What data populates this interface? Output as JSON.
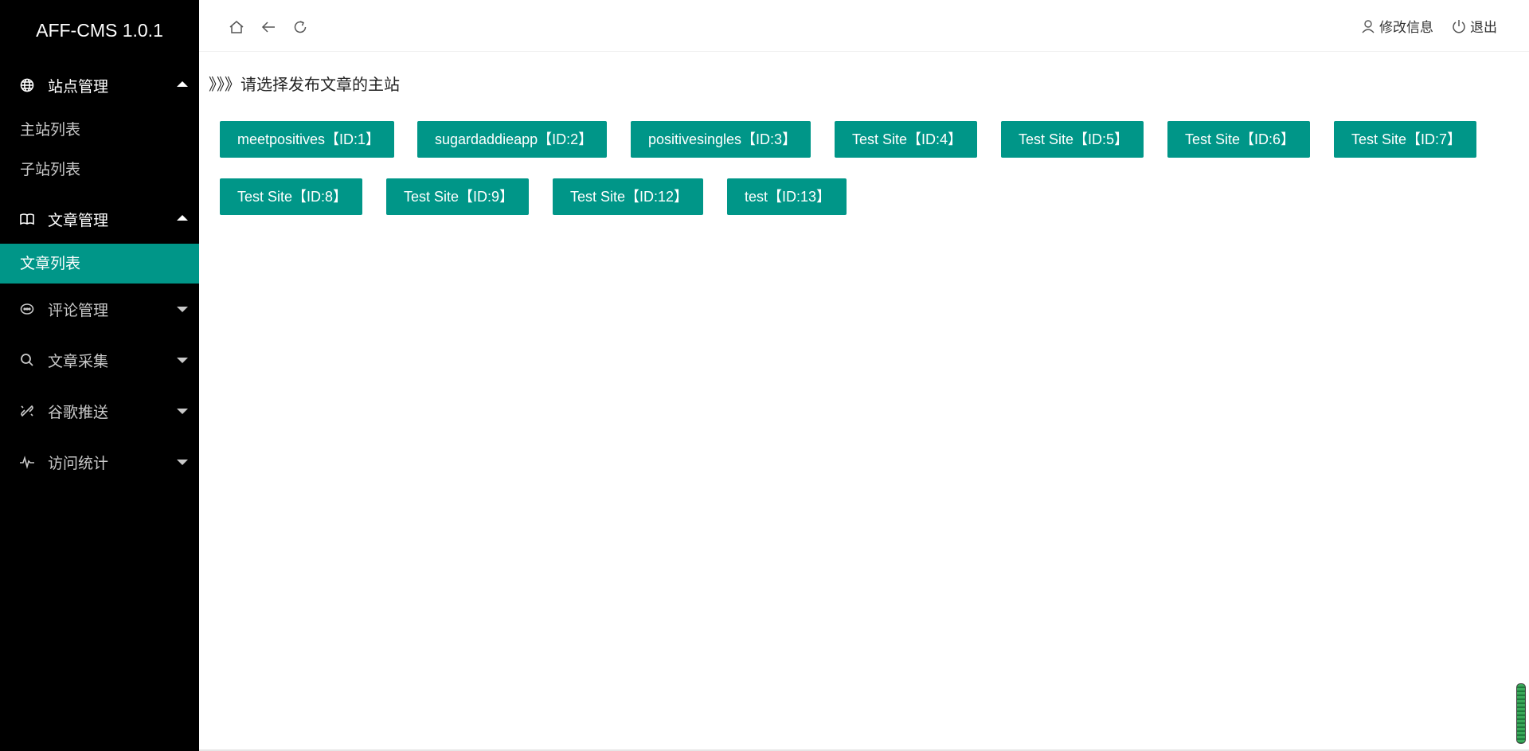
{
  "app": {
    "title": "AFF-CMS 1.0.1"
  },
  "sidebar": {
    "groups": [
      {
        "label": "站点管理",
        "icon": "globe-icon",
        "expanded": true,
        "items": [
          {
            "label": "主站列表"
          },
          {
            "label": "子站列表"
          }
        ]
      },
      {
        "label": "文章管理",
        "icon": "book-icon",
        "expanded": true,
        "items": [
          {
            "label": "文章列表",
            "active": true
          }
        ]
      },
      {
        "label": "评论管理",
        "icon": "comment-icon",
        "expanded": false
      },
      {
        "label": "文章采集",
        "icon": "search-icon",
        "expanded": false
      },
      {
        "label": "谷歌推送",
        "icon": "link-icon",
        "expanded": false
      },
      {
        "label": "访问统计",
        "icon": "pulse-icon",
        "expanded": false
      }
    ]
  },
  "header": {
    "nav_icons": [
      "home-icon",
      "back-arrow-icon",
      "refresh-icon"
    ],
    "edit_info": "修改信息",
    "logout": "退出"
  },
  "main": {
    "prompt": "》》》请选择发布文章的主站",
    "sites": [
      "meetpositives【ID:1】",
      "sugardaddieapp【ID:2】",
      "positivesingles【ID:3】",
      "Test Site【ID:4】",
      "Test Site【ID:5】",
      "Test Site【ID:6】",
      "Test Site【ID:7】",
      "Test Site【ID:8】",
      "Test Site【ID:9】",
      "Test Site【ID:12】",
      "test【ID:13】"
    ]
  },
  "colors": {
    "sidebar_bg": "#000000",
    "accent": "#009688"
  }
}
